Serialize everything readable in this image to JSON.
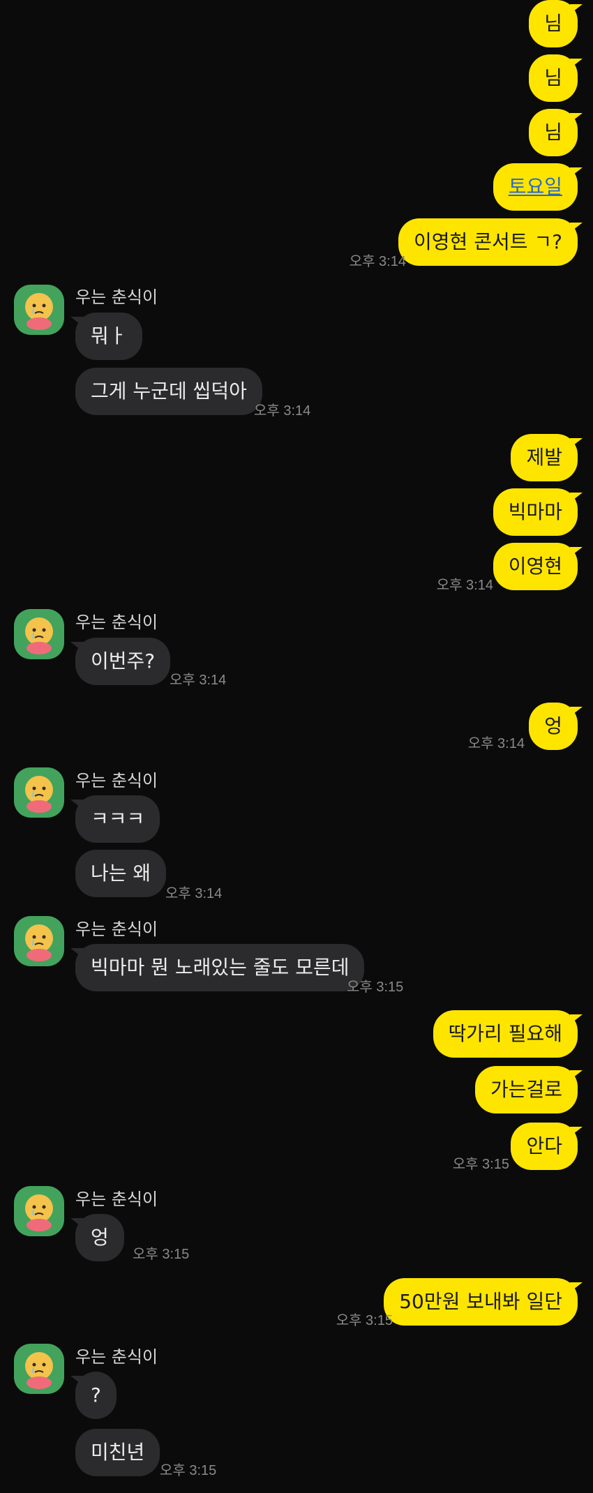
{
  "me_color": "#fee500",
  "them_color": "#2b2b2d",
  "background": "#0b0b0b",
  "sender_name": "우는 춘식이",
  "avatar_icon": "choonsik-crying-avatar-icon",
  "messages": {
    "m1": "님",
    "m2": "님",
    "m3": "님",
    "m4": "토요일",
    "m5": "이영현 콘서트 ㄱ?",
    "t1": "오후 3:14",
    "r1": "뭐ㅏ",
    "r2": "그게 누군데 씹덕아",
    "t2": "오후 3:14",
    "m6": "제발",
    "m7": "빅마마",
    "m8": "이영현",
    "t3": "오후 3:14",
    "r3": "이번주?",
    "t4": "오후 3:14",
    "m9": "엉",
    "t5": "오후 3:14",
    "r4": "ㅋㅋㅋ",
    "r5": "나는 왜",
    "t6": "오후 3:14",
    "r6": "빅마마 뭔 노래있는 줄도 모른데",
    "t7": "오후 3:15",
    "m10": "딱가리 필요해",
    "m11": "가는걸로",
    "m12": "안다",
    "t8": "오후 3:15",
    "r7": "엉",
    "t9": "오후 3:15",
    "m13": "50만원 보내봐 일단",
    "t10": "오후 3:15",
    "r8": "?",
    "r9": "미친년",
    "t11": "오후 3:15"
  }
}
